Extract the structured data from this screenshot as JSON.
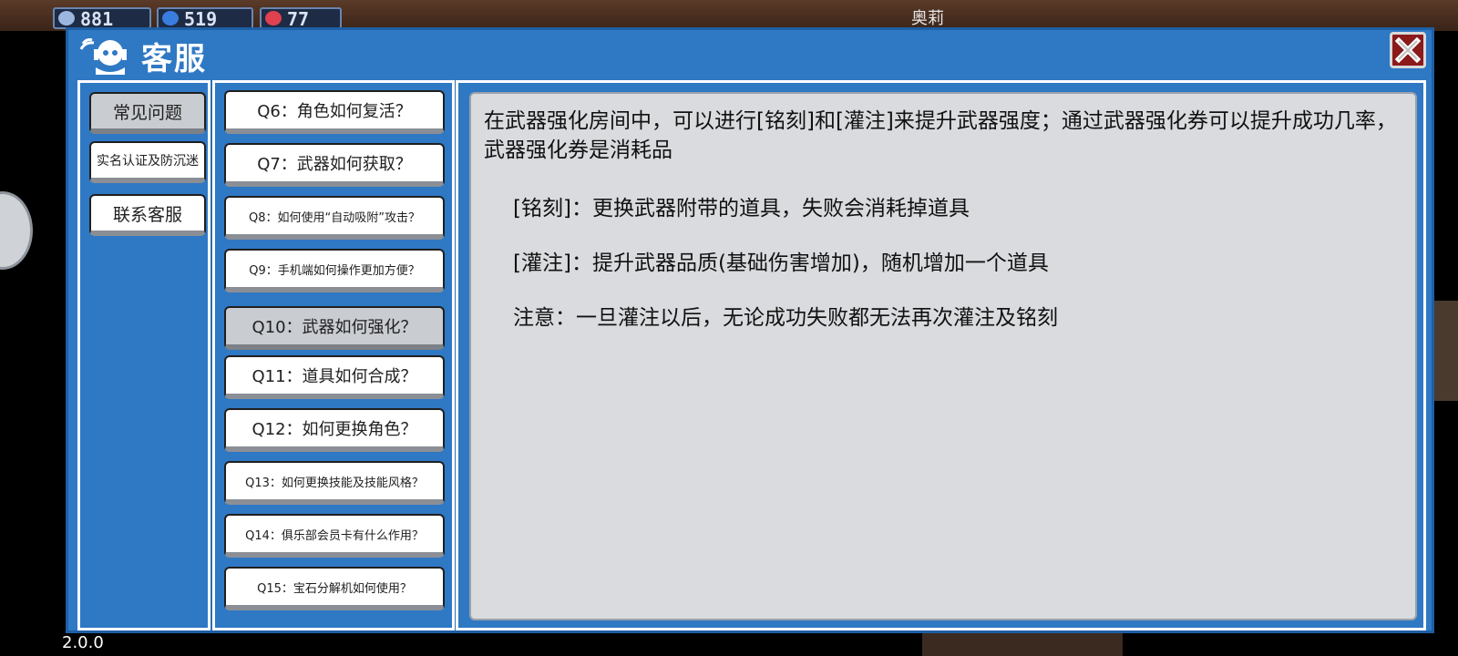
{
  "background": {
    "hud": [
      {
        "value": "881",
        "color": "#9bb7e0"
      },
      {
        "value": "519",
        "color": "#3a7de0"
      },
      {
        "value": "77",
        "color": "#e04050"
      }
    ],
    "npc_name": "奥莉"
  },
  "dialog": {
    "title": "客服",
    "title_icon": "headset-support-icon",
    "close_icon": "close-x-icon"
  },
  "categories": [
    {
      "label": "常见问题",
      "selected": true
    },
    {
      "label": "实名认证及防沉迷",
      "selected": false
    },
    {
      "label": "联系客服",
      "selected": false
    }
  ],
  "faq": [
    {
      "label": "Q6：角色如何复活？"
    },
    {
      "label": "Q7：武器如何获取？"
    },
    {
      "label": "Q8：如何使用“自动吸附”攻击？"
    },
    {
      "label": "Q9：手机端如何操作更加方便？"
    },
    {
      "label": "Q10：武器如何强化？",
      "selected": true
    },
    {
      "label": "Q11：道具如何合成？"
    },
    {
      "label": "Q12：如何更换角色？"
    },
    {
      "label": "Q13：如何更换技能及技能风格？"
    },
    {
      "label": "Q14：俱乐部会员卡有什么作用？"
    },
    {
      "label": "Q15：宝石分解机如何使用？"
    }
  ],
  "answer": {
    "paragraph": "在武器强化房间中，可以进行[铭刻]和[灌注]来提升武器强度；通过武器强化券可以提升成功几率，武器强化券是消耗品",
    "line1": "[铭刻]：更换武器附带的道具，失败会消耗掉道具",
    "line2": "[灌注]：提升武器品质(基础伤害增加)，随机增加一个道具",
    "line3": "注意：一旦灌注以后，无论成功失败都无法再次灌注及铭刻"
  },
  "version": "2.0.0"
}
